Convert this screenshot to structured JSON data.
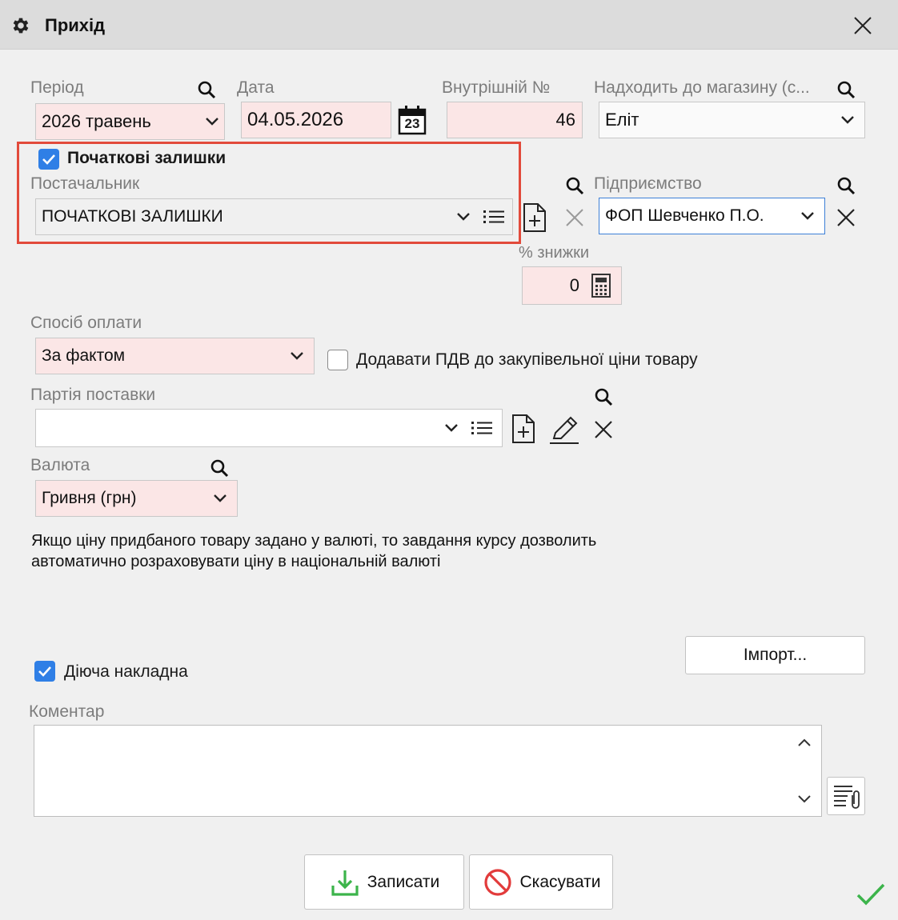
{
  "window": {
    "title": "Прихід",
    "settings_icon": "gear-icon",
    "close_icon": "close-icon"
  },
  "period": {
    "label": "Період",
    "value": "2026 травень"
  },
  "date": {
    "label": "Дата",
    "value": "04.05.2026",
    "calendar_day": "23"
  },
  "internal_number": {
    "label": "Внутрішній №",
    "value": "46"
  },
  "store": {
    "label": "Надходить до магазину (с...",
    "value": "Еліт"
  },
  "opening_balances": {
    "label": "Початкові залишки",
    "checked": true
  },
  "supplier": {
    "label": "Постачальник",
    "value": "ПОЧАТКОВІ ЗАЛИШКИ"
  },
  "enterprise": {
    "label": "Підприємство",
    "value": "ФОП Шевченко П.О."
  },
  "discount": {
    "label": "% знижки",
    "value": "0"
  },
  "payment_method": {
    "label": "Спосіб оплати",
    "value": "За фактом"
  },
  "add_vat": {
    "label": "Додавати ПДВ до закупівельної ціни товару",
    "checked": false
  },
  "delivery_batch": {
    "label": "Партія поставки",
    "value": ""
  },
  "currency": {
    "label": "Валюта",
    "value": "Гривня (грн)"
  },
  "currency_info": {
    "line1": "Якщо ціну придбаного товару задано у валюті, то завдання курсу дозволить",
    "line2": "автоматично розраховувати ціну в національній валюті"
  },
  "import_button": {
    "label": "Імпорт..."
  },
  "active_invoice": {
    "label": "Діюча накладна",
    "checked": true
  },
  "comment": {
    "label": "Коментар",
    "value": ""
  },
  "save_button": {
    "label": "Записати"
  },
  "cancel_button": {
    "label": "Скасувати"
  },
  "colors": {
    "accent": "#2f7fe6",
    "required_field": "#fbe6e6",
    "highlight": "#e24a3b",
    "success": "#3cb44b"
  }
}
